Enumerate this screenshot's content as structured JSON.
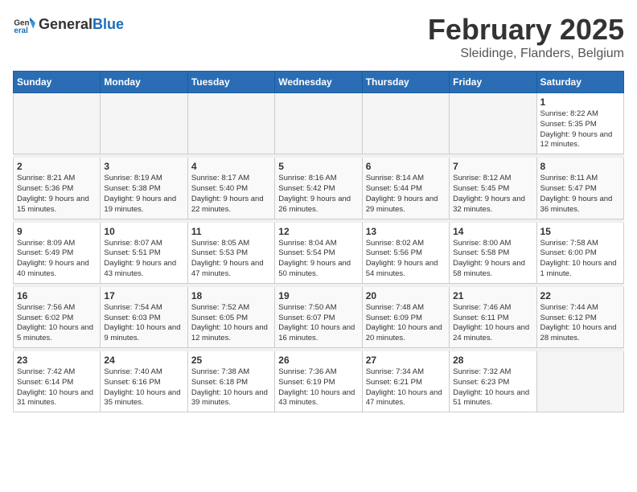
{
  "header": {
    "logo_general": "General",
    "logo_blue": "Blue",
    "month_title": "February 2025",
    "location": "Sleidinge, Flanders, Belgium"
  },
  "days_of_week": [
    "Sunday",
    "Monday",
    "Tuesday",
    "Wednesday",
    "Thursday",
    "Friday",
    "Saturday"
  ],
  "weeks": [
    [
      {
        "day": "",
        "info": ""
      },
      {
        "day": "",
        "info": ""
      },
      {
        "day": "",
        "info": ""
      },
      {
        "day": "",
        "info": ""
      },
      {
        "day": "",
        "info": ""
      },
      {
        "day": "",
        "info": ""
      },
      {
        "day": "1",
        "info": "Sunrise: 8:22 AM\nSunset: 5:35 PM\nDaylight: 9 hours and 12 minutes."
      }
    ],
    [
      {
        "day": "2",
        "info": "Sunrise: 8:21 AM\nSunset: 5:36 PM\nDaylight: 9 hours and 15 minutes."
      },
      {
        "day": "3",
        "info": "Sunrise: 8:19 AM\nSunset: 5:38 PM\nDaylight: 9 hours and 19 minutes."
      },
      {
        "day": "4",
        "info": "Sunrise: 8:17 AM\nSunset: 5:40 PM\nDaylight: 9 hours and 22 minutes."
      },
      {
        "day": "5",
        "info": "Sunrise: 8:16 AM\nSunset: 5:42 PM\nDaylight: 9 hours and 26 minutes."
      },
      {
        "day": "6",
        "info": "Sunrise: 8:14 AM\nSunset: 5:44 PM\nDaylight: 9 hours and 29 minutes."
      },
      {
        "day": "7",
        "info": "Sunrise: 8:12 AM\nSunset: 5:45 PM\nDaylight: 9 hours and 32 minutes."
      },
      {
        "day": "8",
        "info": "Sunrise: 8:11 AM\nSunset: 5:47 PM\nDaylight: 9 hours and 36 minutes."
      }
    ],
    [
      {
        "day": "9",
        "info": "Sunrise: 8:09 AM\nSunset: 5:49 PM\nDaylight: 9 hours and 40 minutes."
      },
      {
        "day": "10",
        "info": "Sunrise: 8:07 AM\nSunset: 5:51 PM\nDaylight: 9 hours and 43 minutes."
      },
      {
        "day": "11",
        "info": "Sunrise: 8:05 AM\nSunset: 5:53 PM\nDaylight: 9 hours and 47 minutes."
      },
      {
        "day": "12",
        "info": "Sunrise: 8:04 AM\nSunset: 5:54 PM\nDaylight: 9 hours and 50 minutes."
      },
      {
        "day": "13",
        "info": "Sunrise: 8:02 AM\nSunset: 5:56 PM\nDaylight: 9 hours and 54 minutes."
      },
      {
        "day": "14",
        "info": "Sunrise: 8:00 AM\nSunset: 5:58 PM\nDaylight: 9 hours and 58 minutes."
      },
      {
        "day": "15",
        "info": "Sunrise: 7:58 AM\nSunset: 6:00 PM\nDaylight: 10 hours and 1 minute."
      }
    ],
    [
      {
        "day": "16",
        "info": "Sunrise: 7:56 AM\nSunset: 6:02 PM\nDaylight: 10 hours and 5 minutes."
      },
      {
        "day": "17",
        "info": "Sunrise: 7:54 AM\nSunset: 6:03 PM\nDaylight: 10 hours and 9 minutes."
      },
      {
        "day": "18",
        "info": "Sunrise: 7:52 AM\nSunset: 6:05 PM\nDaylight: 10 hours and 12 minutes."
      },
      {
        "day": "19",
        "info": "Sunrise: 7:50 AM\nSunset: 6:07 PM\nDaylight: 10 hours and 16 minutes."
      },
      {
        "day": "20",
        "info": "Sunrise: 7:48 AM\nSunset: 6:09 PM\nDaylight: 10 hours and 20 minutes."
      },
      {
        "day": "21",
        "info": "Sunrise: 7:46 AM\nSunset: 6:11 PM\nDaylight: 10 hours and 24 minutes."
      },
      {
        "day": "22",
        "info": "Sunrise: 7:44 AM\nSunset: 6:12 PM\nDaylight: 10 hours and 28 minutes."
      }
    ],
    [
      {
        "day": "23",
        "info": "Sunrise: 7:42 AM\nSunset: 6:14 PM\nDaylight: 10 hours and 31 minutes."
      },
      {
        "day": "24",
        "info": "Sunrise: 7:40 AM\nSunset: 6:16 PM\nDaylight: 10 hours and 35 minutes."
      },
      {
        "day": "25",
        "info": "Sunrise: 7:38 AM\nSunset: 6:18 PM\nDaylight: 10 hours and 39 minutes."
      },
      {
        "day": "26",
        "info": "Sunrise: 7:36 AM\nSunset: 6:19 PM\nDaylight: 10 hours and 43 minutes."
      },
      {
        "day": "27",
        "info": "Sunrise: 7:34 AM\nSunset: 6:21 PM\nDaylight: 10 hours and 47 minutes."
      },
      {
        "day": "28",
        "info": "Sunrise: 7:32 AM\nSunset: 6:23 PM\nDaylight: 10 hours and 51 minutes."
      },
      {
        "day": "",
        "info": ""
      }
    ]
  ]
}
